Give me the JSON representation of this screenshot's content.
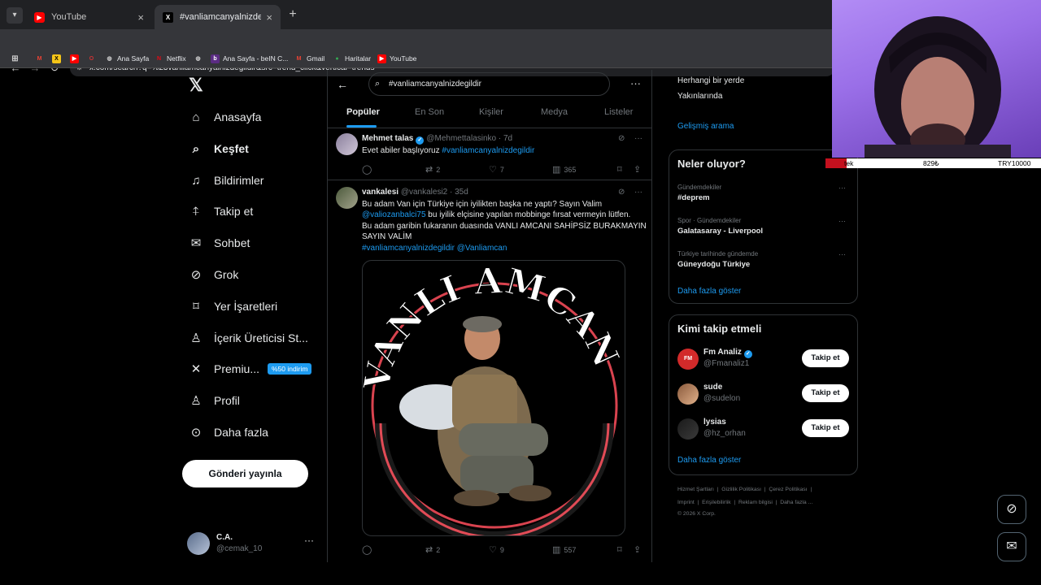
{
  "browser": {
    "tabs": [
      {
        "title": "YouTube",
        "active": false
      },
      {
        "title": "#vanliamcanyalnizdegildir - Ara",
        "active": true
      }
    ],
    "url": "x.com/search?q=%23vanliamcanyalnizdegildir&src=trend_click&vertical=trends",
    "bookmarks": [
      "Ana Sayfa",
      "Netflix",
      "Ana Sayfa - beIN C...",
      "Gmail",
      "Haritalar",
      "YouTube"
    ]
  },
  "sidebar": {
    "items": [
      {
        "label": "Anasayfa",
        "icon": "home-icon"
      },
      {
        "label": "Keşfet",
        "icon": "search-icon"
      },
      {
        "label": "Bildirimler",
        "icon": "bell-icon"
      },
      {
        "label": "Takip et",
        "icon": "add-user-icon"
      },
      {
        "label": "Sohbet",
        "icon": "mail-icon"
      },
      {
        "label": "Grok",
        "icon": "grok-icon"
      },
      {
        "label": "Yer İşaretleri",
        "icon": "bookmark-icon"
      },
      {
        "label": "İçerik Üreticisi St...",
        "icon": "creator-icon"
      },
      {
        "label": "Premiu...",
        "icon": "x-logo-icon"
      },
      {
        "label": "Profil",
        "icon": "profile-icon"
      },
      {
        "label": "Daha fazla",
        "icon": "more-icon"
      }
    ],
    "premium_badge": "%50 indirim",
    "post_button": "Gönderi yayınla",
    "account": {
      "name": "C.A.",
      "handle": "@cemak_10"
    }
  },
  "search": {
    "query": "#vanliamcanyalnizdegildir",
    "tabs": [
      "Popüler",
      "En Son",
      "Kişiler",
      "Medya",
      "Listeler"
    ]
  },
  "tweets": [
    {
      "name": "Mehmet talas",
      "handle": "@Mehmettalasinko · 7d",
      "text_plain": "Evet abiler başlıyoruz ",
      "hashtag": "#vanliamcanyalnizdegildir",
      "replies": "",
      "retweets": "2",
      "likes": "7",
      "views": "365"
    },
    {
      "name": "vankalesi",
      "handle": "@vankalesi2 · 35d",
      "text_line1": "Bu adam Van için Türkiye için iyilikten başka ne yaptı? Sayın Valim",
      "mention1": "@valiozanbalci75",
      "text_line2": " bu iyilik elçisine yapılan mobbinge fırsat vermeyin lütfen.",
      "text_line3": "Bu adam garibin  fukaranın duasında VANLI AMCANI SAHİPSİZ BURAKMAYIN SAYIN VALİM",
      "hashtag": "#vanliamcanyalnizdegildir",
      "mention2": "@Vanliamcan",
      "image_text": "VANLI AMCAN",
      "replies": "",
      "retweets": "2",
      "likes": "9",
      "views": "557"
    }
  ],
  "right": {
    "location_options": [
      "Herhangi bir yerde",
      "Yakınlarında"
    ],
    "advanced_search": "Gelişmiş arama",
    "trends_title": "Neler oluyor?",
    "trends": [
      {
        "context": "Gündemdekiler",
        "name": "#deprem"
      },
      {
        "context": "Spor · Gündemdekiler",
        "name": "Galatasaray - Liverpool"
      },
      {
        "context": "Türkiye tarihinde gündemde",
        "name": "Güneydoğu Türkiye"
      }
    ],
    "show_more": "Daha fazla göster",
    "who_title": "Kimi takip etmeli",
    "who": [
      {
        "name": "Fm Analiz",
        "handle": "@Fmanaliz1",
        "button": "Takip et"
      },
      {
        "name": "sude",
        "handle": "@sudelon",
        "button": "Takip et"
      },
      {
        "name": "lysias",
        "handle": "@hz_orhan",
        "button": "Takip et"
      }
    ],
    "who_show_more": "Daha fazla göster",
    "footer_row1": [
      "Hizmet Şartları",
      "|",
      "Gizlilik Politikası",
      "|",
      "Çerez Politikası",
      "|"
    ],
    "footer_row2": [
      "Imprint",
      "|",
      "Erişilebilirlik",
      "|",
      "Reklam bilgisi",
      "|",
      "Daha fazla ..."
    ],
    "copyright": "© 2026 X Corp."
  },
  "overlay": {
    "ticker": [
      "tek",
      "829₺",
      "TRY10000"
    ]
  }
}
